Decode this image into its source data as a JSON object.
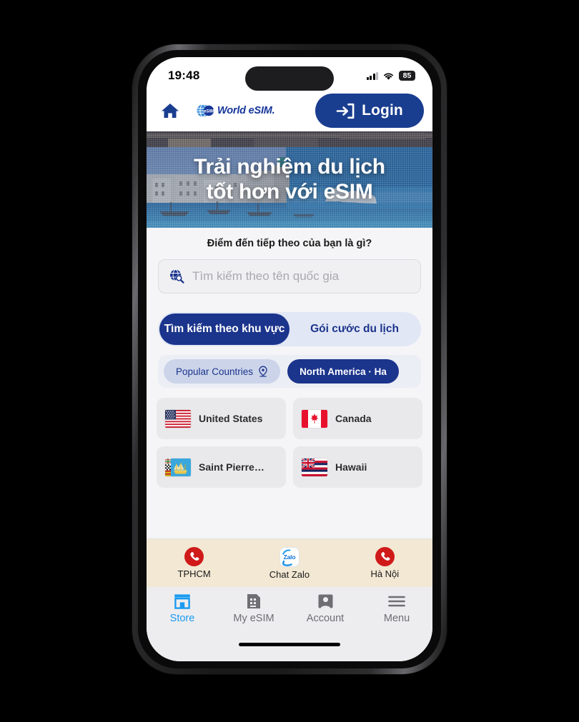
{
  "status_bar": {
    "time": "19:48",
    "battery_level": "85",
    "signal_icon": "cellular-signal-icon",
    "wifi_icon": "wifi-icon"
  },
  "header": {
    "home_icon": "home-icon",
    "brand_text": "World eSIM.",
    "brand_logo_badge": "eSIM",
    "login_label": "Login",
    "login_icon": "login-arrow-icon",
    "login_bg": "#193d8f"
  },
  "hero": {
    "line1": "Trải nghiệm du lịch",
    "line2": "tốt hơn với eSIM"
  },
  "search": {
    "heading": "Điểm đến tiếp theo của bạn là gì?",
    "placeholder": "Tìm kiếm theo tên quốc gia",
    "value": "",
    "icon": "globe-search-icon"
  },
  "mode_tabs": [
    {
      "label": "Tìm kiếm theo khu vực",
      "active": true
    },
    {
      "label": "Gói cước du lịch",
      "active": false
    }
  ],
  "region_chips": [
    {
      "label": "Popular Countries",
      "icon": "location-pin-icon",
      "active": false
    },
    {
      "label": "North America · Ha",
      "icon": "",
      "active": true
    }
  ],
  "countries": [
    {
      "name": "United States",
      "flag": "flag-us"
    },
    {
      "name": "Canada",
      "flag": "flag-ca"
    },
    {
      "name": "Saint Pierre…",
      "flag": "flag-pm"
    },
    {
      "name": "Hawaii",
      "flag": "flag-hi"
    }
  ],
  "contact_bar": [
    {
      "label": "TPHCM",
      "icon": "phone-icon"
    },
    {
      "label": "Chat Zalo",
      "icon": "zalo-icon",
      "icon_text": "Zalo"
    },
    {
      "label": "Hà Nội",
      "icon": "phone-icon"
    }
  ],
  "bottom_nav": [
    {
      "label": "Store",
      "icon": "store-icon",
      "active": true
    },
    {
      "label": "My eSIM",
      "icon": "sim-card-icon",
      "active": false
    },
    {
      "label": "Account",
      "icon": "account-icon",
      "active": false
    },
    {
      "label": "Menu",
      "icon": "hamburger-menu-icon",
      "active": false
    }
  ],
  "colors": {
    "brand_navy": "#1b348c",
    "accent_blue": "#1b9bf0",
    "contact_bar_bg": "#f2e8d3",
    "phone_red": "#d01a1a"
  }
}
